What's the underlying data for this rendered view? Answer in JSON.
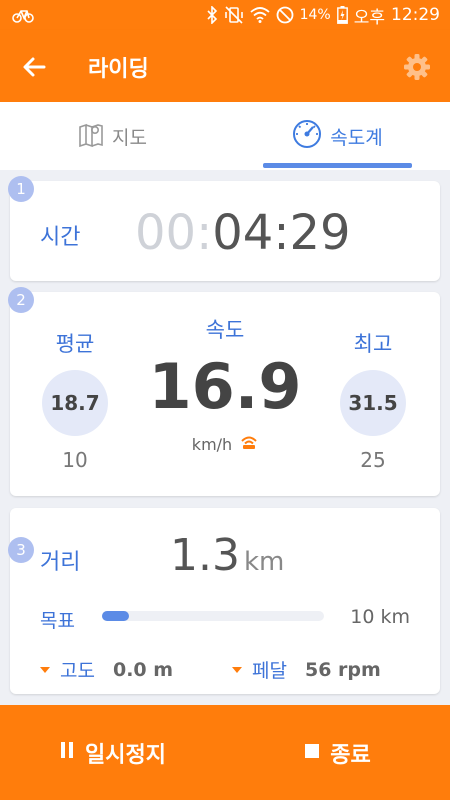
{
  "status_bar": {
    "battery": "14%",
    "period": "오후",
    "time": "12:29",
    "left_icon": "bicycle-icon",
    "icons": [
      "bluetooth-icon",
      "vibrate-mute-icon",
      "wifi-icon",
      "do-not-disturb-icon",
      "battery-charging-icon"
    ]
  },
  "appbar": {
    "title": "라이딩",
    "back_icon": "arrow-left-icon",
    "settings_icon": "gear-icon"
  },
  "tabs": [
    {
      "label": "지도",
      "icon": "map-icon",
      "selected": false
    },
    {
      "label": "속도계",
      "icon": "compass-icon",
      "selected": true
    }
  ],
  "time_card": {
    "badge": "1",
    "label": "시간",
    "value_dim": "00:",
    "value": "04:29"
  },
  "speed_card": {
    "badge": "2",
    "avg_label": "평균",
    "avg_value": "18.7",
    "avg_sub": "10",
    "center_label": "속도",
    "speed": "16.9",
    "unit": "km/h",
    "unit_icon": "sensor-signal-icon",
    "max_label": "최고",
    "max_value": "31.5",
    "max_sub": "25"
  },
  "distance_card": {
    "badge": "3",
    "label": "거리",
    "value": "1.3",
    "unit": "km",
    "goal_label": "목표",
    "goal_progress": 0.12,
    "goal_value": "10 km",
    "altitude_label": "고도",
    "altitude_value": "0.0 m",
    "cadence_label": "페달",
    "cadence_value": "56 rpm"
  },
  "bottom_bar": {
    "pause_label": "일시정지",
    "stop_label": "종료"
  },
  "colors": {
    "accent": "#ff7d0c",
    "blue": "#3d73d8",
    "tab_indicator": "#5b8be6",
    "badge": "#aebff0",
    "circle": "#e4e9f8"
  }
}
